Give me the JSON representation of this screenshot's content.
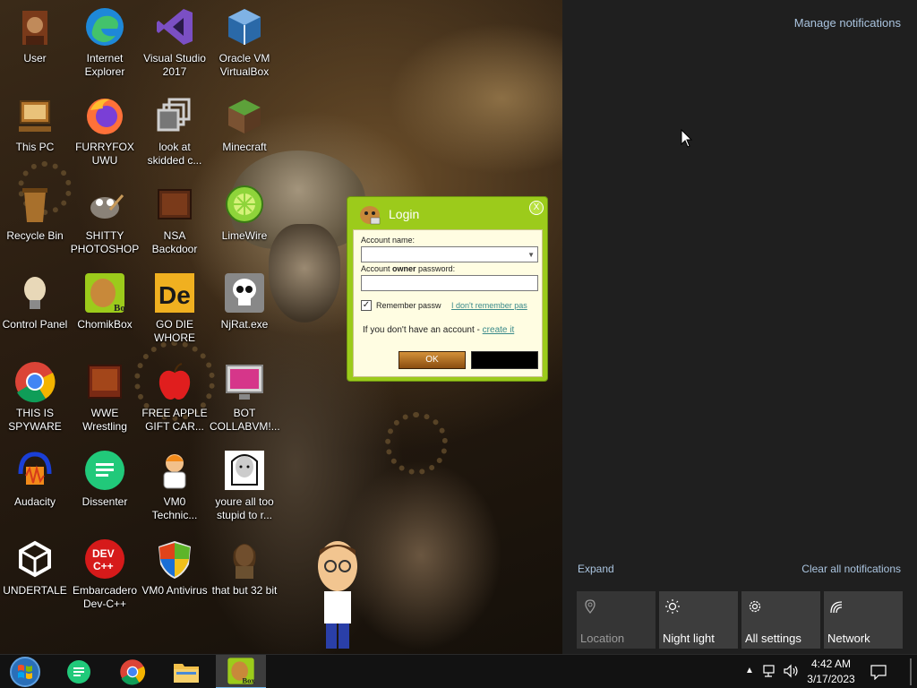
{
  "desktop": {
    "icons": [
      {
        "label": "User",
        "icon": "user-folder-icon"
      },
      {
        "label": "Internet Explorer",
        "icon": "edge-icon"
      },
      {
        "label": "Visual Studio 2017",
        "icon": "visual-studio-icon"
      },
      {
        "label": "Oracle VM VirtualBox",
        "icon": "virtualbox-icon"
      },
      {
        "label": "This PC",
        "icon": "computer-icon"
      },
      {
        "label": "FURRYFOX UWU",
        "icon": "firefox-icon"
      },
      {
        "label": "look at skidded c...",
        "icon": "shortcut-icon"
      },
      {
        "label": "Minecraft",
        "icon": "minecraft-icon"
      },
      {
        "label": "Recycle Bin",
        "icon": "recycle-bin-icon"
      },
      {
        "label": "SHITTY PHOTOSHOP",
        "icon": "gimp-icon"
      },
      {
        "label": "NSA Backdoor",
        "icon": "nsa-backdoor-icon"
      },
      {
        "label": "LimeWire",
        "icon": "limewire-icon"
      },
      {
        "label": "Control Panel",
        "icon": "control-panel-icon"
      },
      {
        "label": "ChomikBox",
        "icon": "chomikbox-icon"
      },
      {
        "label": "GO DIE WHORE",
        "icon": "de-icon"
      },
      {
        "label": "NjRat.exe",
        "icon": "skull-icon"
      },
      {
        "label": "THIS IS SPYWARE",
        "icon": "chrome-icon"
      },
      {
        "label": "WWE Wrestling",
        "icon": "wwe-icon"
      },
      {
        "label": "FREE APPLE GIFT CAR...",
        "icon": "apple-icon"
      },
      {
        "label": "BOT COLLABVM!...",
        "icon": "bot-collab-icon"
      },
      {
        "label": "Audacity",
        "icon": "audacity-icon"
      },
      {
        "label": "Dissenter",
        "icon": "dissenter-icon"
      },
      {
        "label": "VM0 Technic...",
        "icon": "technician-icon"
      },
      {
        "label": "youre all too stupid to r...",
        "icon": "portrait-icon"
      },
      {
        "label": "UNDERTALE",
        "icon": "unity-icon"
      },
      {
        "label": "Embarcadero Dev-C++",
        "icon": "devcpp-icon"
      },
      {
        "label": "VM0 Antivirus",
        "icon": "shield-icon"
      },
      {
        "label": "that but 32 bit",
        "icon": "lady-portrait-icon"
      }
    ]
  },
  "login_dialog": {
    "title": "Login",
    "account_name_label": "Account name:",
    "password_label_pre": "Account ",
    "password_label_bold": "owner",
    "password_label_post": " password:",
    "account_name_value": "",
    "password_value": "",
    "remember_label": "Remember passw",
    "remember_checked": true,
    "forgot_link": "I don't remember pas",
    "no_account_text": "If you don't have an account - ",
    "create_link": "create it",
    "ok_label": "OK",
    "close_label": "X",
    "accent_color": "#9ccb1b"
  },
  "action_center": {
    "manage_notifications": "Manage notifications",
    "expand": "Expand",
    "clear_all": "Clear all notifications",
    "quick_actions": [
      {
        "label": "Location",
        "icon": "location-icon",
        "enabled": false
      },
      {
        "label": "Night light",
        "icon": "night-light-icon",
        "enabled": true
      },
      {
        "label": "All settings",
        "icon": "gear-icon",
        "enabled": true
      },
      {
        "label": "Network",
        "icon": "network-icon",
        "enabled": true
      }
    ]
  },
  "taskbar": {
    "pinned": [
      {
        "name": "start-button",
        "icon": "windows-logo-icon"
      },
      {
        "name": "dissenter-taskbar",
        "icon": "dissenter-icon"
      },
      {
        "name": "chrome-taskbar",
        "icon": "chrome-icon"
      },
      {
        "name": "file-explorer-taskbar",
        "icon": "folder-icon"
      },
      {
        "name": "chomikbox-taskbar",
        "icon": "chomikbox-icon",
        "active": true
      }
    ],
    "clock_time": "4:42 AM",
    "clock_date": "3/17/2023"
  }
}
